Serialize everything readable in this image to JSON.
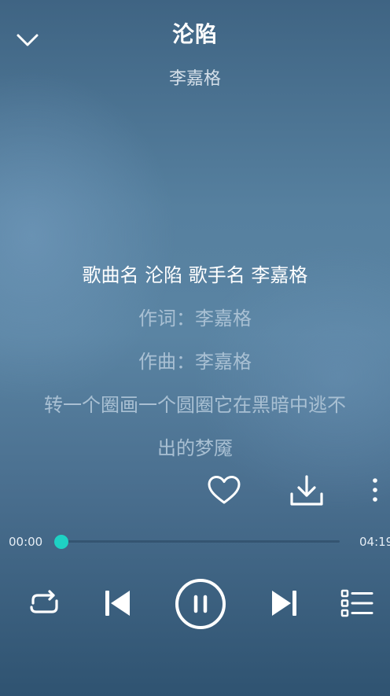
{
  "song": {
    "title": "沦陷",
    "artist": "李嘉格"
  },
  "lyrics": [
    "歌曲名 沦陷 歌手名 李嘉格",
    "作词：李嘉格",
    "作曲：李嘉格",
    "转一个圈画一个圆圈它在黑暗中逃不",
    "出的梦魇"
  ],
  "progress": {
    "current": "00:00",
    "total": "04:19",
    "fraction": 0.0
  },
  "colors": {
    "accent": "#1ed2c4",
    "lyric_active": "#ffffff",
    "lyric_inactive": "#a9c0d3"
  },
  "icons": {
    "collapse": "chevron-down-icon",
    "favorite": "heart-icon",
    "download": "download-icon",
    "more": "more-vertical-icon",
    "repeat": "repeat-icon",
    "previous": "skip-previous-icon",
    "play_pause": "pause-icon",
    "next": "skip-next-icon",
    "playlist": "playlist-icon"
  }
}
